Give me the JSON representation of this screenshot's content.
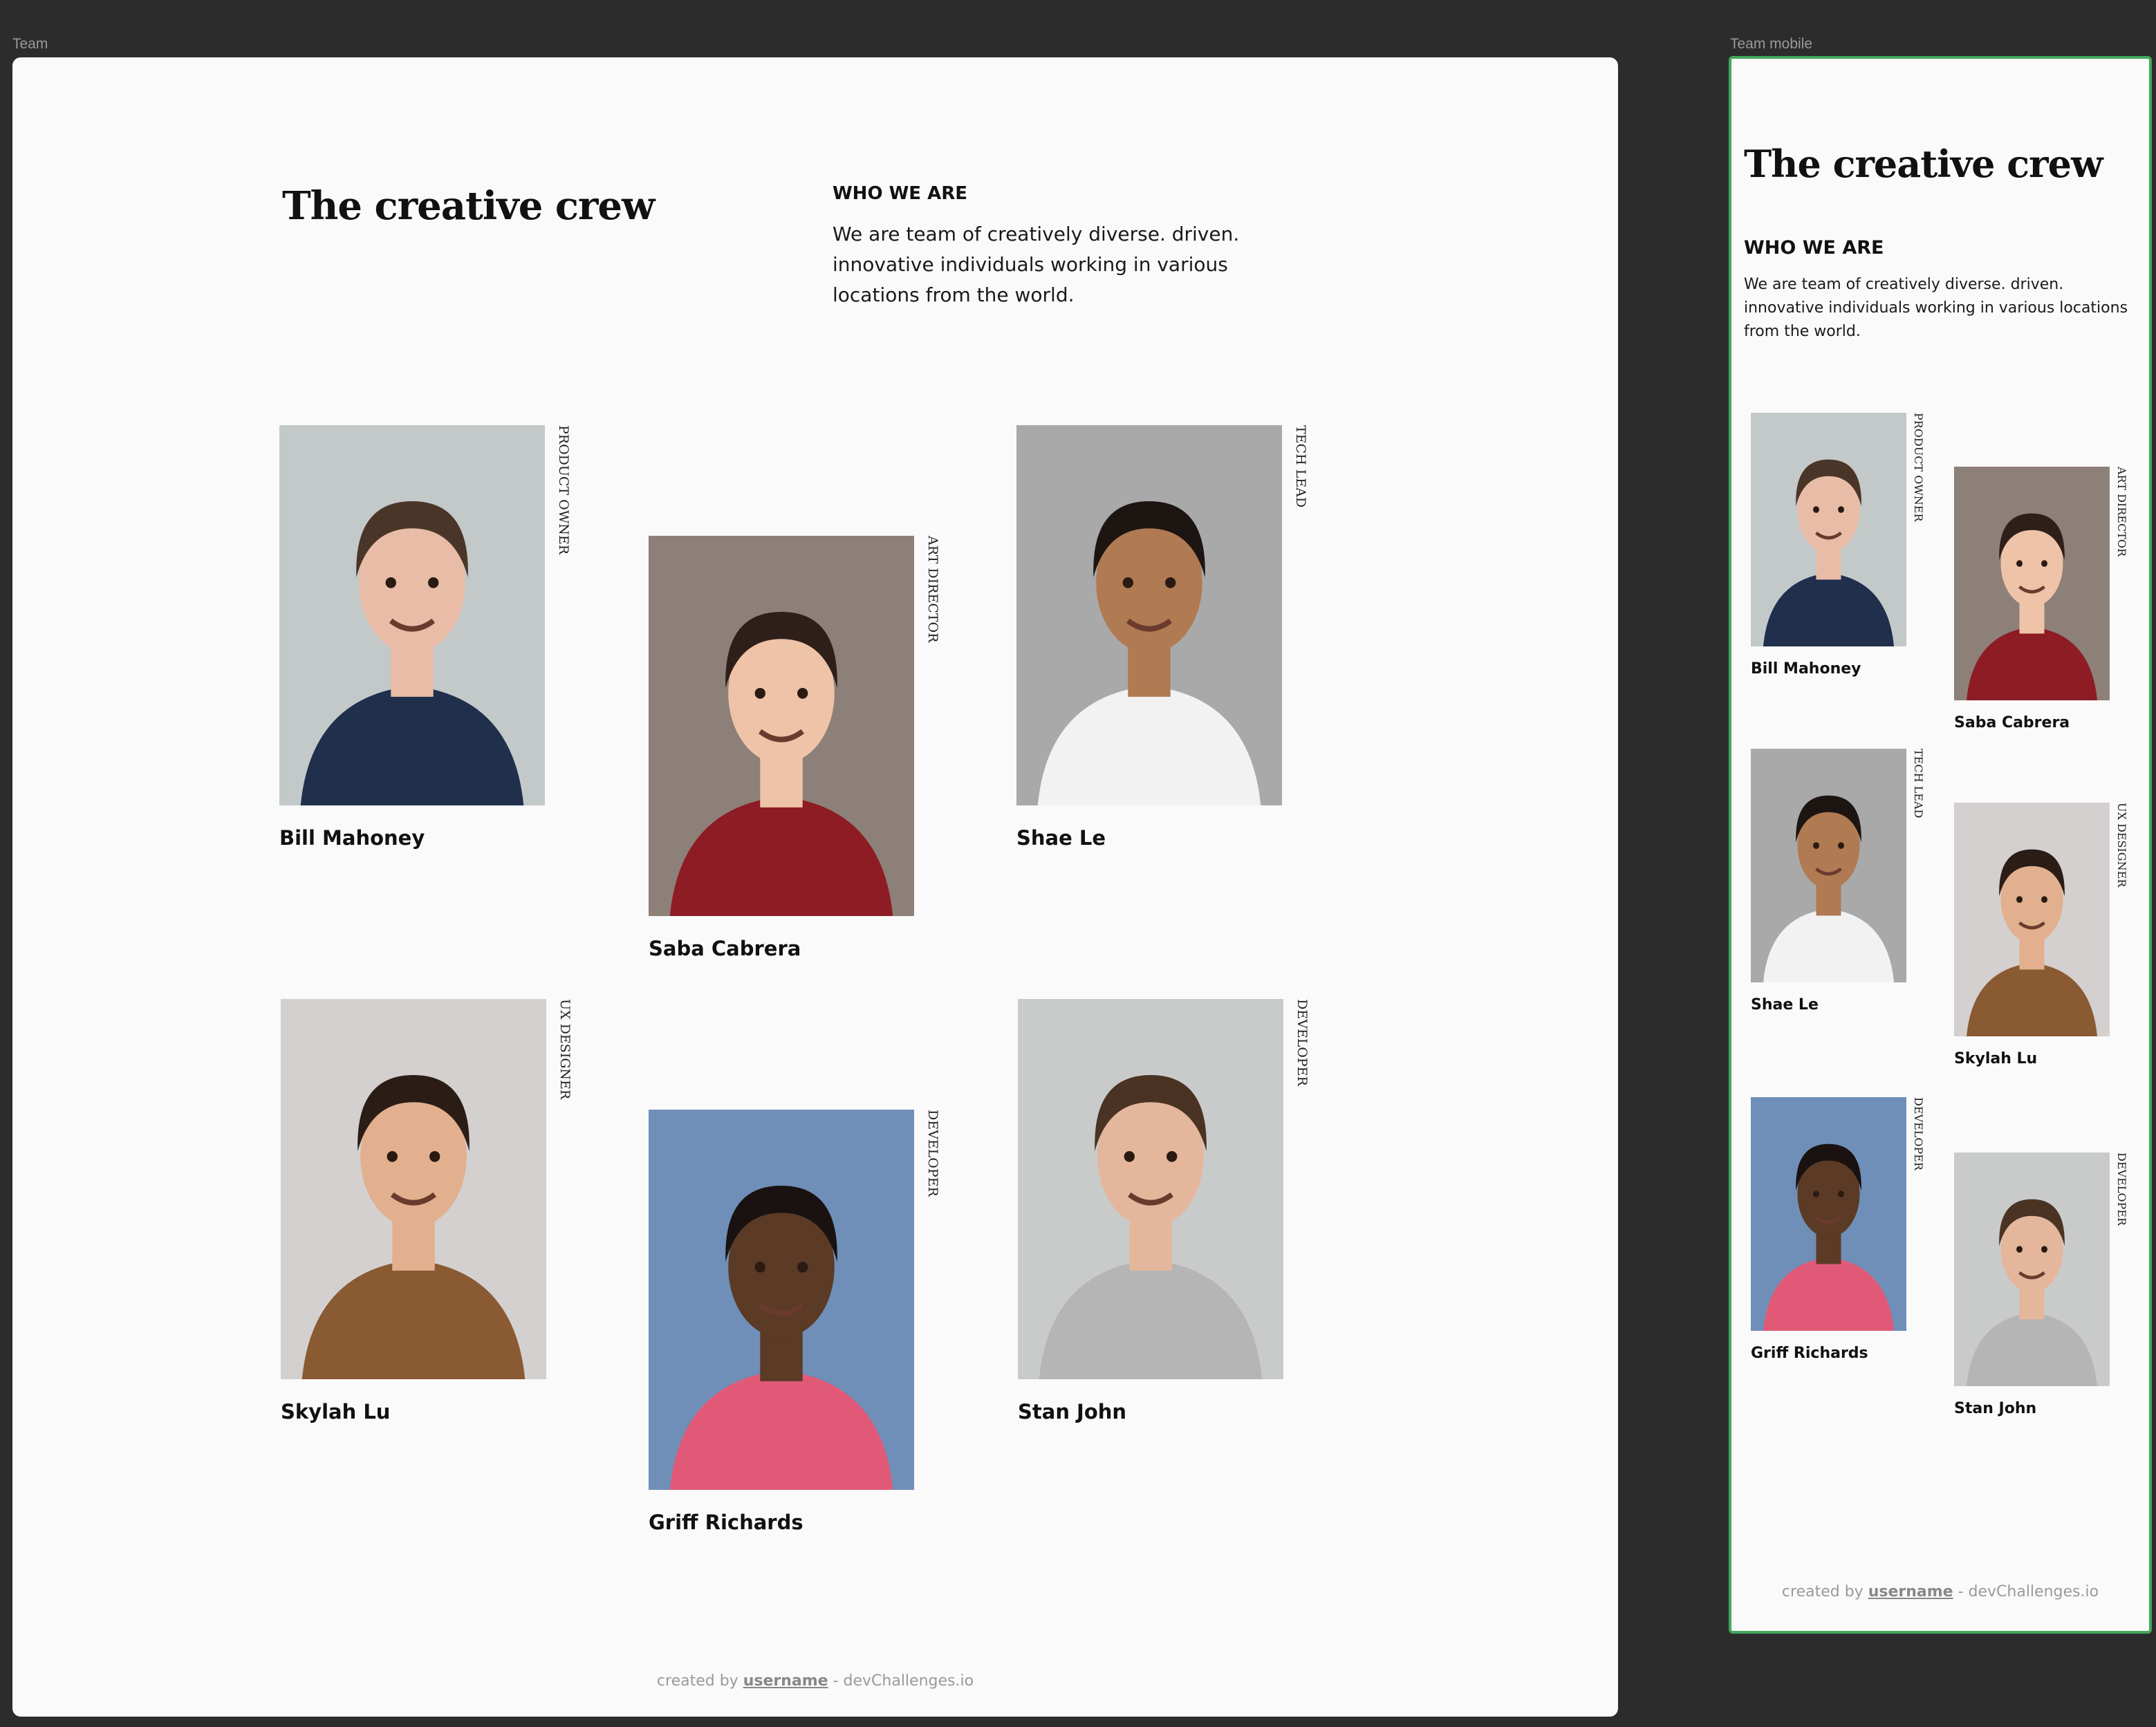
{
  "frames": {
    "desktop_label": "Team",
    "mobile_label": "Team mobile"
  },
  "hero": {
    "title": "The creative crew",
    "subtitle": "WHO WE ARE",
    "description": "We are team of creatively diverse.  driven. innovative individuals working in various locations from the world."
  },
  "members": [
    {
      "name": "Bill Mahoney",
      "role": "PRODUCT OWNER",
      "photo": "portrait-man-navy-shirt"
    },
    {
      "name": "Saba Cabrera",
      "role": "ART DIRECTOR",
      "photo": "portrait-woman-red-top"
    },
    {
      "name": "Shae Le",
      "role": "TECH LEAD",
      "photo": "portrait-man-white-tee"
    },
    {
      "name": "Skylah Lu",
      "role": "UX DESIGNER",
      "photo": "portrait-woman-leopard-top"
    },
    {
      "name": "Griff Richards",
      "role": "DEVELOPER",
      "photo": "portrait-man-striped-shirt"
    },
    {
      "name": "Stan John",
      "role": "DEVELOPER",
      "photo": "portrait-man-grey-sweater"
    }
  ],
  "footer": {
    "prefix": "created by ",
    "username": "username",
    "suffix": " - devChallenges.io"
  },
  "colors": {
    "background": "#2c2c2c",
    "frame": "#fafafa",
    "mobile_selection": "#3fa85a"
  }
}
